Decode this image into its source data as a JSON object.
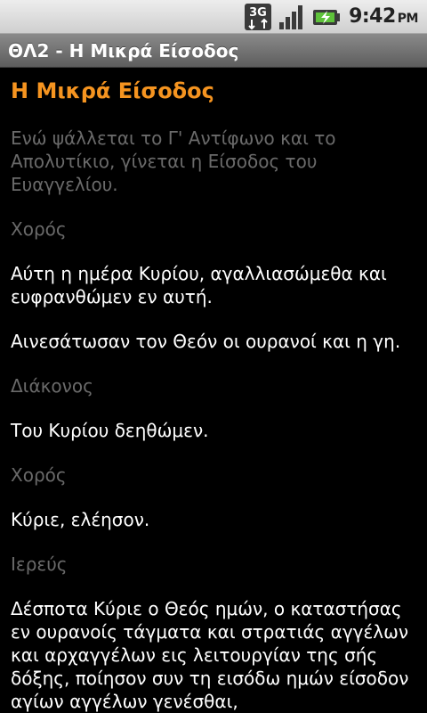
{
  "status_bar": {
    "network_label": "3G",
    "time": "9:42",
    "ampm": "PM",
    "icons": [
      "3g-data-icon",
      "signal-strength-icon",
      "battery-charging-icon"
    ]
  },
  "title_bar": {
    "title": "ΘΛ2 - Η Μικρά Είσοδος"
  },
  "content": {
    "heading": "Η Μικρά Είσοδος",
    "blocks": [
      {
        "type": "rubric",
        "text": "Ενώ ψάλλεται το Γ' Αντίφωνο και το Απολυτίκιο, γίνεται η Είσοδος του Ευαγγελίου."
      },
      {
        "type": "speaker",
        "text": "Χορός"
      },
      {
        "type": "text",
        "text": "Αύτη η ημέρα Κυρίου, αγαλλιασώμεθα και ευφρανθώμεν εν αυτή."
      },
      {
        "type": "text",
        "text": "Αινεσάτωσαν τον Θεόν οι ουρανοί και η γη."
      },
      {
        "type": "speaker",
        "text": "Διάκονος"
      },
      {
        "type": "text",
        "text": "Του Κυρίου δεηθώμεν."
      },
      {
        "type": "speaker",
        "text": "Χορός"
      },
      {
        "type": "text",
        "text": "Κύριε, ελέησον."
      },
      {
        "type": "speaker",
        "text": "Ιερεύς"
      },
      {
        "type": "text",
        "text": "Δέσποτα Κύριε ο Θεός ημών, ο καταστήσας εν ουρανοίς τάγματα και στρατιάς αγγέλων και αρχαγγέλων εις λειτουργίαν της σής δόξης, ποίησον συν τη εισόδω ημών είσοδον αγίων αγγέλων γενέσθαι,"
      }
    ]
  },
  "colors": {
    "heading": "#f59420",
    "rubric": "#6a6a6a",
    "text": "#ffffff",
    "background": "#000000"
  }
}
